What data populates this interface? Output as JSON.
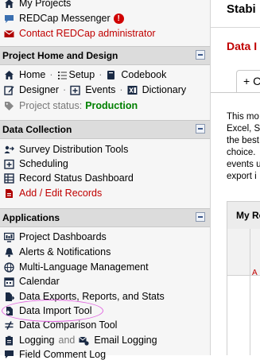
{
  "sidebar": {
    "top_links": [
      {
        "label": "My Projects",
        "icon": "home-icon"
      },
      {
        "label": "REDCap Messenger",
        "icon": "chat-icon",
        "badge": "!"
      },
      {
        "label": "Contact REDCap administrator",
        "icon": "envelope-icon"
      }
    ],
    "project_home": {
      "header": "Project Home and Design",
      "home": "Home",
      "setup": "Setup",
      "codebook": "Codebook",
      "designer": "Designer",
      "events": "Events",
      "dictionary": "Dictionary",
      "status_label": "Project status:",
      "status_value": "Production"
    },
    "data_collection": {
      "header": "Data Collection",
      "items": [
        "Survey Distribution Tools",
        "Scheduling",
        "Record Status Dashboard",
        "Add / Edit Records"
      ]
    },
    "applications": {
      "header": "Applications",
      "items": [
        "Project Dashboards",
        "Alerts & Notifications",
        "Multi-Language Management",
        "Calendar",
        "Data Exports, Reports, and Stats",
        "Data Import Tool",
        "Data Comparison Tool"
      ],
      "logging": "Logging",
      "and": "and",
      "email_logging": "Email Logging",
      "cut_off": "Field Comment Log"
    }
  },
  "main": {
    "title": "Stabi",
    "subtitle": "Data I",
    "tab_label": "+ C",
    "body_lines": [
      "This mo",
      "Excel, S",
      "the best",
      "choice.",
      "events u",
      "export i"
    ],
    "section_header": "My Re",
    "table_mark": "A"
  },
  "colors": {
    "sidebar_bg": "#f6f6f6",
    "header_bg": "#dcdcdc",
    "status_green": "#008000",
    "accent_red": "#c00000",
    "annotation_pink": "#e066e0"
  }
}
